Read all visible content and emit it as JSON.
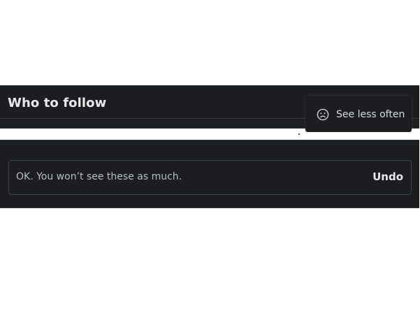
{
  "who_to_follow": {
    "title": "Who to follow"
  },
  "menu": {
    "items": [
      {
        "icon": "frown-face-icon",
        "label": "See less often"
      }
    ]
  },
  "notice": {
    "message": "OK. You won’t see these as much.",
    "undo_label": "Undo"
  },
  "colors": {
    "panel_bg": "#1b1d20",
    "border": "#2c3a40",
    "text_primary": "#e7e9ea",
    "text_secondary": "#b8bcbe"
  }
}
